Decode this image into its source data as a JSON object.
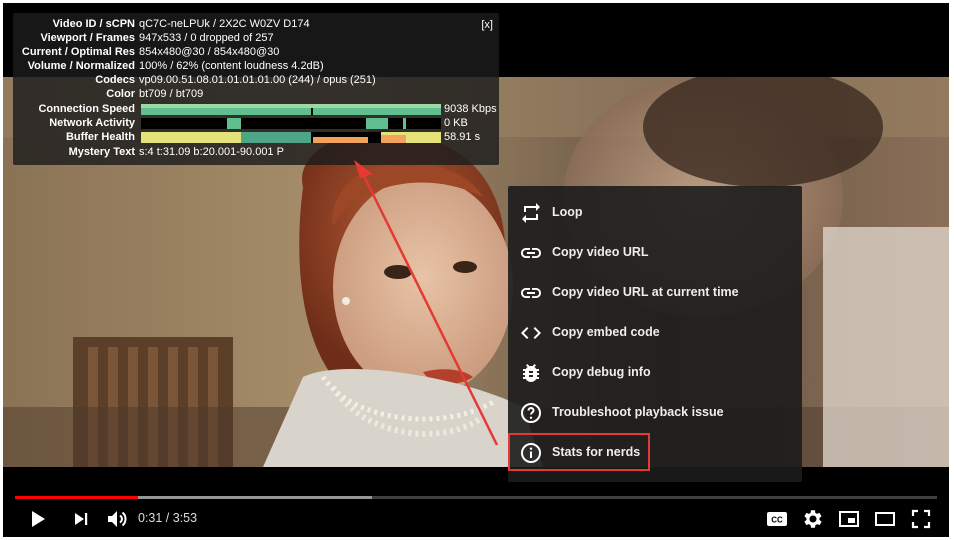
{
  "stats": {
    "close_label": "[x]",
    "rows": [
      {
        "label": "Video ID / sCPN",
        "value": "qC7C-neLPUk / 2X2C W0ZV D174"
      },
      {
        "label": "Viewport / Frames",
        "value": "947x533 / 0 dropped of 257"
      },
      {
        "label": "Current / Optimal Res",
        "value": "854x480@30 / 854x480@30"
      },
      {
        "label": "Volume / Normalized",
        "value": "100% / 62% (content loudness 4.2dB)"
      },
      {
        "label": "Codecs",
        "value": "vp09.00.51.08.01.01.01.01.00 (244) / opus (251)"
      },
      {
        "label": "Color",
        "value": "bt709 / bt709"
      },
      {
        "label": "Connection Speed",
        "value": "9038 Kbps"
      },
      {
        "label": "Network Activity",
        "value": "0 KB"
      },
      {
        "label": "Buffer Health",
        "value": "58.91 s"
      },
      {
        "label": "Mystery Text",
        "value": "s:4 t:31.09 b:20.001-90.001 P"
      }
    ]
  },
  "menu": {
    "items": [
      {
        "label": "Loop",
        "icon": "loop-icon"
      },
      {
        "label": "Copy video URL",
        "icon": "link-icon"
      },
      {
        "label": "Copy video URL at current time",
        "icon": "link-icon"
      },
      {
        "label": "Copy embed code",
        "icon": "code-icon"
      },
      {
        "label": "Copy debug info",
        "icon": "bug-icon"
      },
      {
        "label": "Troubleshoot playback issue",
        "icon": "question-icon"
      },
      {
        "label": "Stats for nerds",
        "icon": "info-icon"
      }
    ]
  },
  "player": {
    "time_display": "0:31 / 3:53",
    "progress_fraction": 0.133,
    "buffered_fraction": 0.387,
    "cc_label": "CC"
  },
  "colors": {
    "highlight": "#e53935",
    "arrow": "#e53935",
    "progress": "#ff0000"
  }
}
